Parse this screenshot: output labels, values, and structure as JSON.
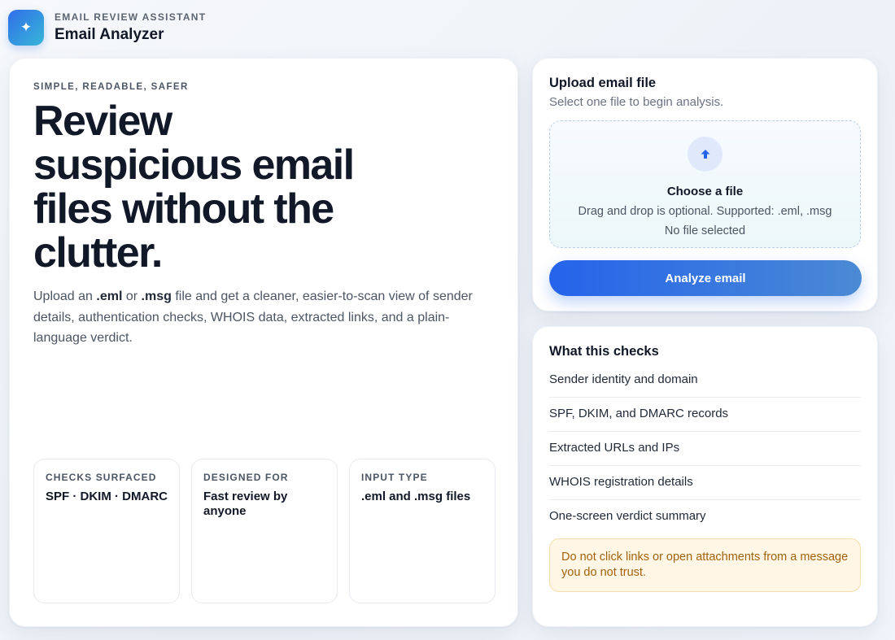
{
  "header": {
    "logo_glyph": "✦",
    "eyebrow": "EMAIL REVIEW ASSISTANT",
    "title": "Email Analyzer"
  },
  "hero": {
    "eyebrow": "SIMPLE, READABLE, SAFER",
    "title": "Review suspicious email files without the clutter.",
    "description": {
      "part1": "Upload an ",
      "ext1": ".eml",
      "part2": " or ",
      "ext2": ".msg",
      "part3": " file and get a cleaner, easier-to-scan view of sender details, authentication checks, WHOIS data, extracted links, and a plain-language verdict."
    },
    "stats": [
      {
        "label": "CHECKS SURFACED",
        "value": "SPF · DKIM · DMARC"
      },
      {
        "label": "DESIGNED FOR",
        "value": "Fast review by anyone"
      },
      {
        "label": "INPUT TYPE",
        "value": ".eml and .msg files"
      }
    ]
  },
  "upload": {
    "title": "Upload email file",
    "subtitle": "Select one file to begin analysis.",
    "dropzone_title": "Choose a file",
    "dropzone_hint": "Drag and drop is optional. Supported: .eml, .msg",
    "file_status": "No file selected",
    "button_label": "Analyze email"
  },
  "checks": {
    "title": "What this checks",
    "items": [
      "Sender identity and domain",
      "SPF, DKIM, and DMARC records",
      "Extracted URLs and IPs",
      "WHOIS registration details",
      "One-screen verdict summary"
    ],
    "warning": "Do not click links or open attachments from a message you do not trust."
  },
  "colors": {
    "accent": "#2563eb",
    "warning_text": "#a3620a",
    "warning_bg": "#fff6e5"
  }
}
